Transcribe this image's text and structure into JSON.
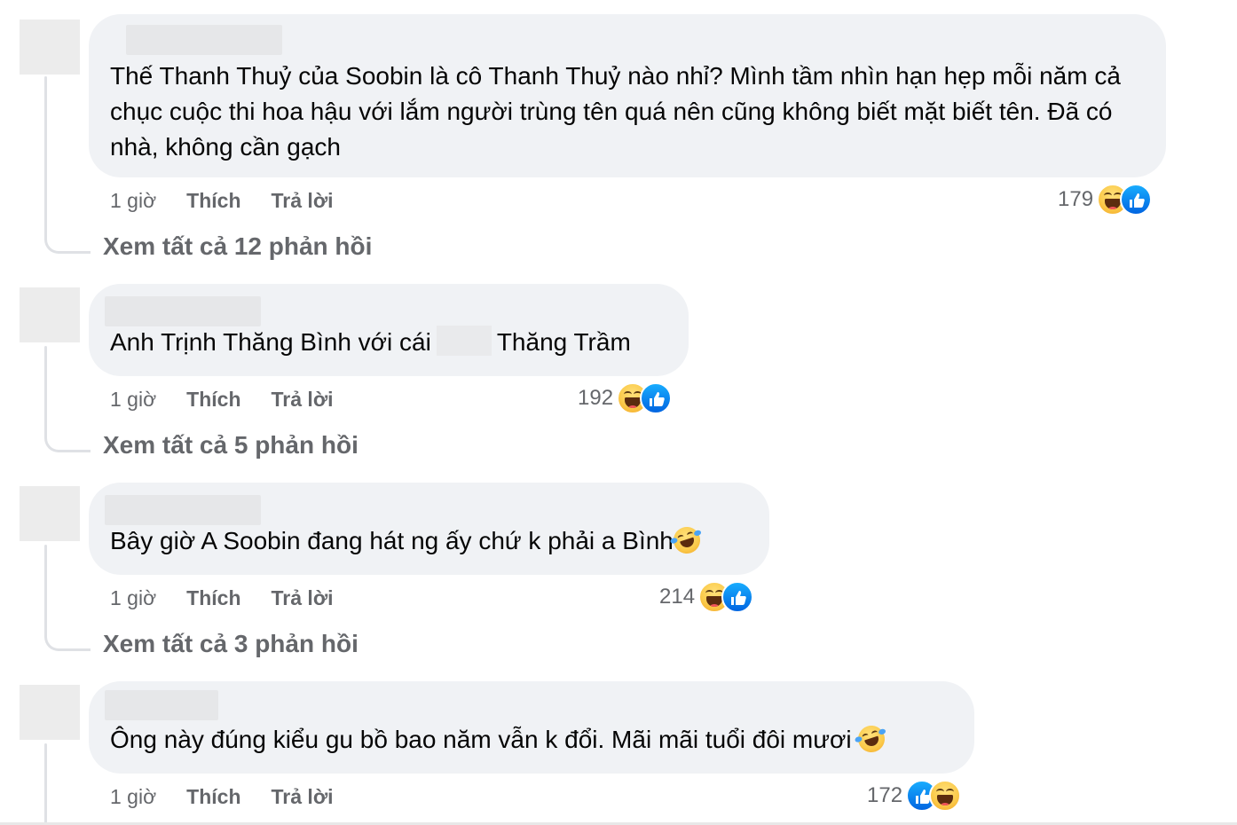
{
  "comments": [
    {
      "text": "Thế Thanh Thuỷ của Soobin là cô Thanh Thuỷ nào nhỉ? Mình tầm nhìn hạn hẹp mỗi năm cả chục cuộc thi hoa hậu với lắm người trùng tên quá nên cũng không biết mặt biết tên. Đã có nhà, không cần gạch",
      "time": "1 giờ",
      "like_label": "Thích",
      "reply_label": "Trả lời",
      "reaction_count": "179",
      "reactions": [
        "haha-icon",
        "like-icon"
      ],
      "view_replies": "Xem tất cả 12 phản hồi"
    },
    {
      "text_before": "Anh Trịnh Thăng Bình với cái",
      "text_after": "Thăng Trầm",
      "time": "1 giờ",
      "like_label": "Thích",
      "reply_label": "Trả lời",
      "reaction_count": "192",
      "reactions": [
        "haha-icon",
        "like-icon"
      ],
      "view_replies": "Xem tất cả 5 phản hồi"
    },
    {
      "text": "Bây giờ A Soobin đang hát ng ấy chứ k phải a Bình",
      "trailing_emoji": "rolling-laughing-emoji",
      "time": "1 giờ",
      "like_label": "Thích",
      "reply_label": "Trả lời",
      "reaction_count": "214",
      "reactions": [
        "haha-icon",
        "like-icon"
      ],
      "view_replies": "Xem tất cả 3 phản hồi"
    },
    {
      "text": "Ông này đúng kiểu gu bồ bao năm vẫn k đổi. Mãi mãi tuổi đôi mươi",
      "trailing_emoji": "rolling-laughing-emoji",
      "time": "1 giờ",
      "like_label": "Thích",
      "reply_label": "Trả lời",
      "reaction_count": "172",
      "reactions": [
        "like-icon",
        "haha-icon"
      ]
    }
  ],
  "colors": {
    "bubble_bg": "#f0f2f5",
    "secondary_text": "#65676b",
    "like_blue": "#0866ff",
    "thread_line": "#dfe1e5"
  }
}
